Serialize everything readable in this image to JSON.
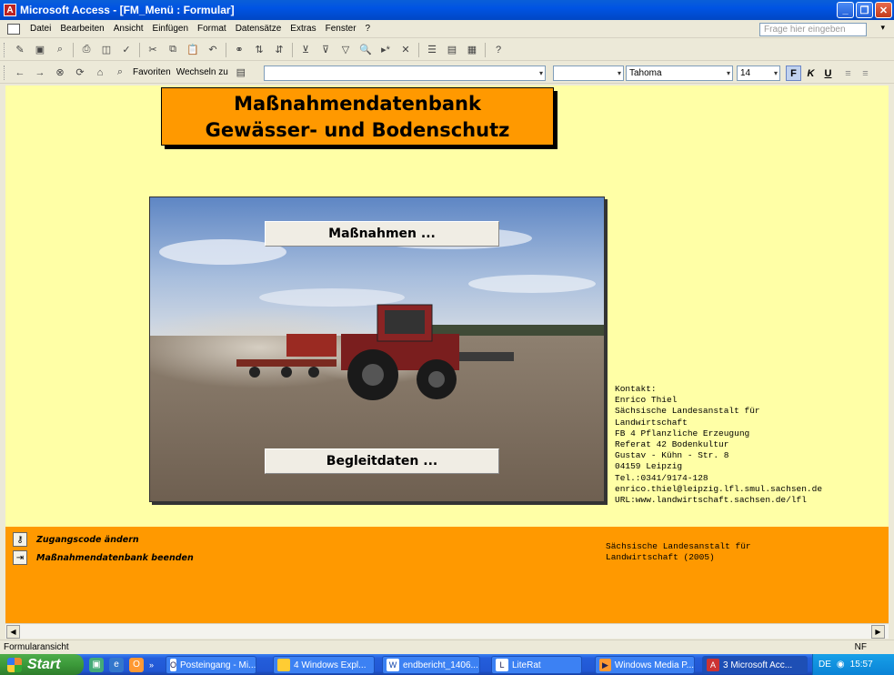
{
  "window": {
    "title": "Microsoft Access - [FM_Menü : Formular]"
  },
  "menubar": {
    "items": [
      "Datei",
      "Bearbeiten",
      "Ansicht",
      "Einfügen",
      "Format",
      "Datensätze",
      "Extras",
      "Fenster",
      "?"
    ],
    "help_placeholder": "Frage hier eingeben"
  },
  "webbar": {
    "favorites": "Favoriten",
    "goto": "Wechseln zu",
    "address": ""
  },
  "format_toolbar": {
    "font": "Tahoma",
    "size": "14",
    "bold": "F",
    "italic": "K",
    "underline": "U"
  },
  "form": {
    "title_line1": "Maßnahmendatenbank",
    "title_line2": "Gewässer- und Bodenschutz",
    "btn_measures": "Maßnahmen ...",
    "btn_companion": "Begleitdaten ...",
    "contact": "Kontakt:\nEnrico Thiel\nSächsische Landesanstalt für\nLandwirtschaft\nFB 4 Pflanzliche Erzeugung\nReferat 42 Bodenkultur\nGustav - Kühn - Str. 8\n04159 Leipzig\nTel.:0341/9174-128\nenrico.thiel@leipzig.lfl.smul.sachsen.de\nURL:www.landwirtschaft.sachsen.de/lfl",
    "footer_link1": "Zugangscode ändern",
    "footer_link2": "Maßnahmendatenbank beenden",
    "credit": "Sächsische Landesanstalt für\nLandwirtschaft (2005)",
    "colors": {
      "background": "#FFFFA6",
      "accent": "#FF9900"
    }
  },
  "statusbar": {
    "left": "Formularansicht",
    "right": "NF"
  },
  "taskbar": {
    "start": "Start",
    "tasks": [
      "Posteingang - Mi...",
      "4 Windows Expl...",
      "endbericht_1406...",
      "LiteRat",
      "Windows Media P...",
      "3 Microsoft Acc..."
    ],
    "lang": "DE",
    "clock": "15:57"
  }
}
